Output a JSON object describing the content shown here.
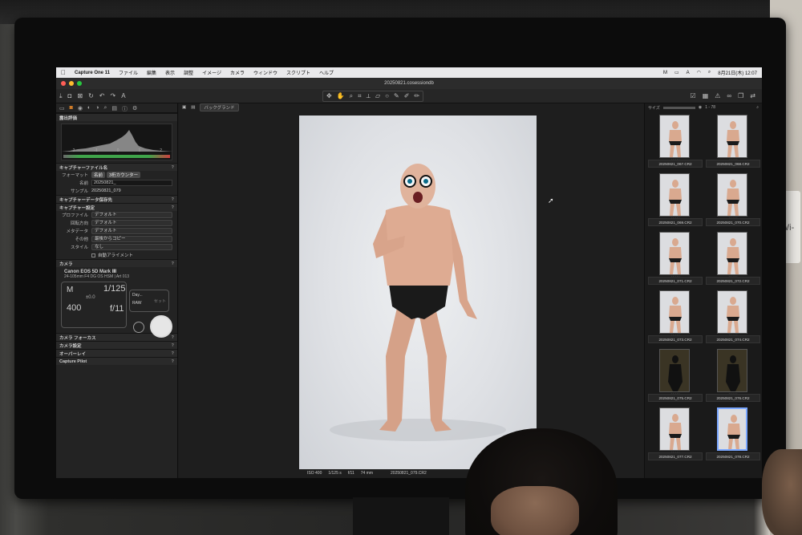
{
  "menubar": {
    "app_name": "Capture One 11",
    "menus": [
      "ファイル",
      "編集",
      "表示",
      "調整",
      "イメージ",
      "カメラ",
      "ウィンドウ",
      "スクリプト",
      "ヘルプ"
    ],
    "clock": "8月21日(木) 12:07"
  },
  "window": {
    "title": "20250821.cosessiondb"
  },
  "viewer": {
    "background_label": "バックグランド",
    "photo_info": {
      "iso": "ISO 400",
      "shutter": "1/125 s",
      "aperture": "f/11",
      "focal": "74 mm",
      "filename": "20250821_079.CR2"
    }
  },
  "left_panel": {
    "histogram_title": "露出評価",
    "histogram_ticks": [
      "-2",
      "-1",
      "0",
      "1",
      "2"
    ],
    "capture_file": {
      "title": "キャプチャーファイル名",
      "format_label": "フォーマット",
      "format_chips": [
        "名前",
        "3桁カウンター"
      ],
      "name_label": "名前",
      "name_value": "20250821_",
      "sample_label": "サンプル",
      "sample_value": "20250821_079"
    },
    "capture_location_title": "キャプチャーデータ保存先",
    "capture_settings": {
      "title": "キャプチャー設定",
      "rows": [
        {
          "label": "プロファイル",
          "value": "デフォルト"
        },
        {
          "label": "回転方向",
          "value": "デフォルト"
        },
        {
          "label": "メタデータ",
          "value": "デフォルト"
        },
        {
          "label": "その他",
          "value": "最後からコピー"
        },
        {
          "label": "スタイル",
          "value": "なし"
        }
      ],
      "auto_align_label": "自動アライメント"
    },
    "camera": {
      "title": "カメラ",
      "model": "Canon EOS 5D Mark Ⅲ",
      "lens": "24-105mm F4 DG OS HSM | Art 013",
      "mode": "M",
      "shutter": "1/125",
      "ev": "±0.0",
      "iso": "400",
      "aperture": "f/11",
      "wb_label": "Day...",
      "raw_label": "RAW",
      "set_label": "セット"
    },
    "more_sections": [
      "カメラ フォーカス",
      "カメラ設定",
      "オーバーレイ",
      "Capture Pilot"
    ]
  },
  "filmstrip": {
    "size_label": "サイズ",
    "count": "1 - 78",
    "thumbnails": [
      {
        "name": "20250821_067.CR2",
        "dark": false,
        "selected": false
      },
      {
        "name": "20250821_068.CR2",
        "dark": false,
        "selected": false
      },
      {
        "name": "20250821_069.CR2",
        "dark": false,
        "selected": false
      },
      {
        "name": "20250821_070.CR2",
        "dark": false,
        "selected": false
      },
      {
        "name": "20250821_071.CR2",
        "dark": false,
        "selected": false
      },
      {
        "name": "20250821_072.CR2",
        "dark": false,
        "selected": false
      },
      {
        "name": "20250821_073.CR2",
        "dark": false,
        "selected": false
      },
      {
        "name": "20250821_074.CR2",
        "dark": false,
        "selected": false
      },
      {
        "name": "20250821_075.CR2",
        "dark": true,
        "selected": false
      },
      {
        "name": "20250821_076.CR2",
        "dark": true,
        "selected": false
      },
      {
        "name": "20250821_077.CR2",
        "dark": false,
        "selected": false
      },
      {
        "name": "20250821_078.CR2",
        "dark": false,
        "selected": true
      }
    ]
  },
  "wall_sign": "Wi-",
  "colors": {
    "accent": "#e98a2a",
    "selection": "#7aa7ff",
    "histogram_green": "#3fa44a"
  }
}
